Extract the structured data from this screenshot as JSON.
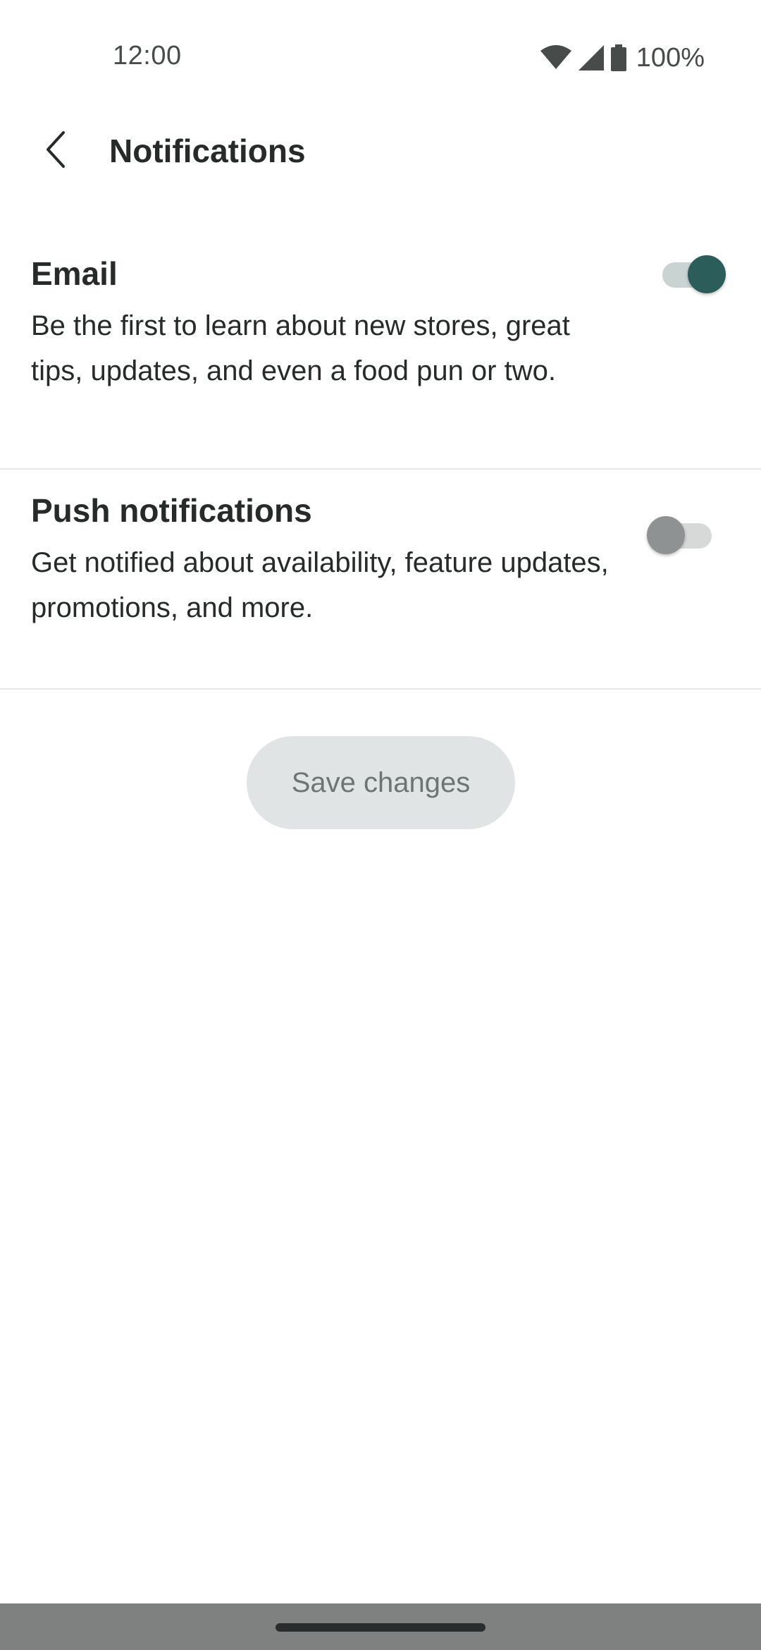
{
  "status_bar": {
    "time": "12:00",
    "battery": "100%",
    "icons": [
      "wifi-icon",
      "signal-icon",
      "battery-icon"
    ]
  },
  "app_bar": {
    "title": "Notifications",
    "back_icon": "back-arrow-icon"
  },
  "settings": [
    {
      "title": "Email",
      "description": "Be the first to learn about new stores, great tips, updates, and even a food pun or two.",
      "enabled": true
    },
    {
      "title": "Push notifications",
      "description": "Get notified about availability, feature updates, promotions, and more.",
      "enabled": false
    }
  ],
  "save_button": {
    "label": "Save changes",
    "disabled": true
  },
  "colors": {
    "accent": "#2b5d5b",
    "text": "#262b2a",
    "button_bg": "#e1e4e4",
    "button_text": "#6e7473",
    "divider": "#e6e8e8"
  }
}
